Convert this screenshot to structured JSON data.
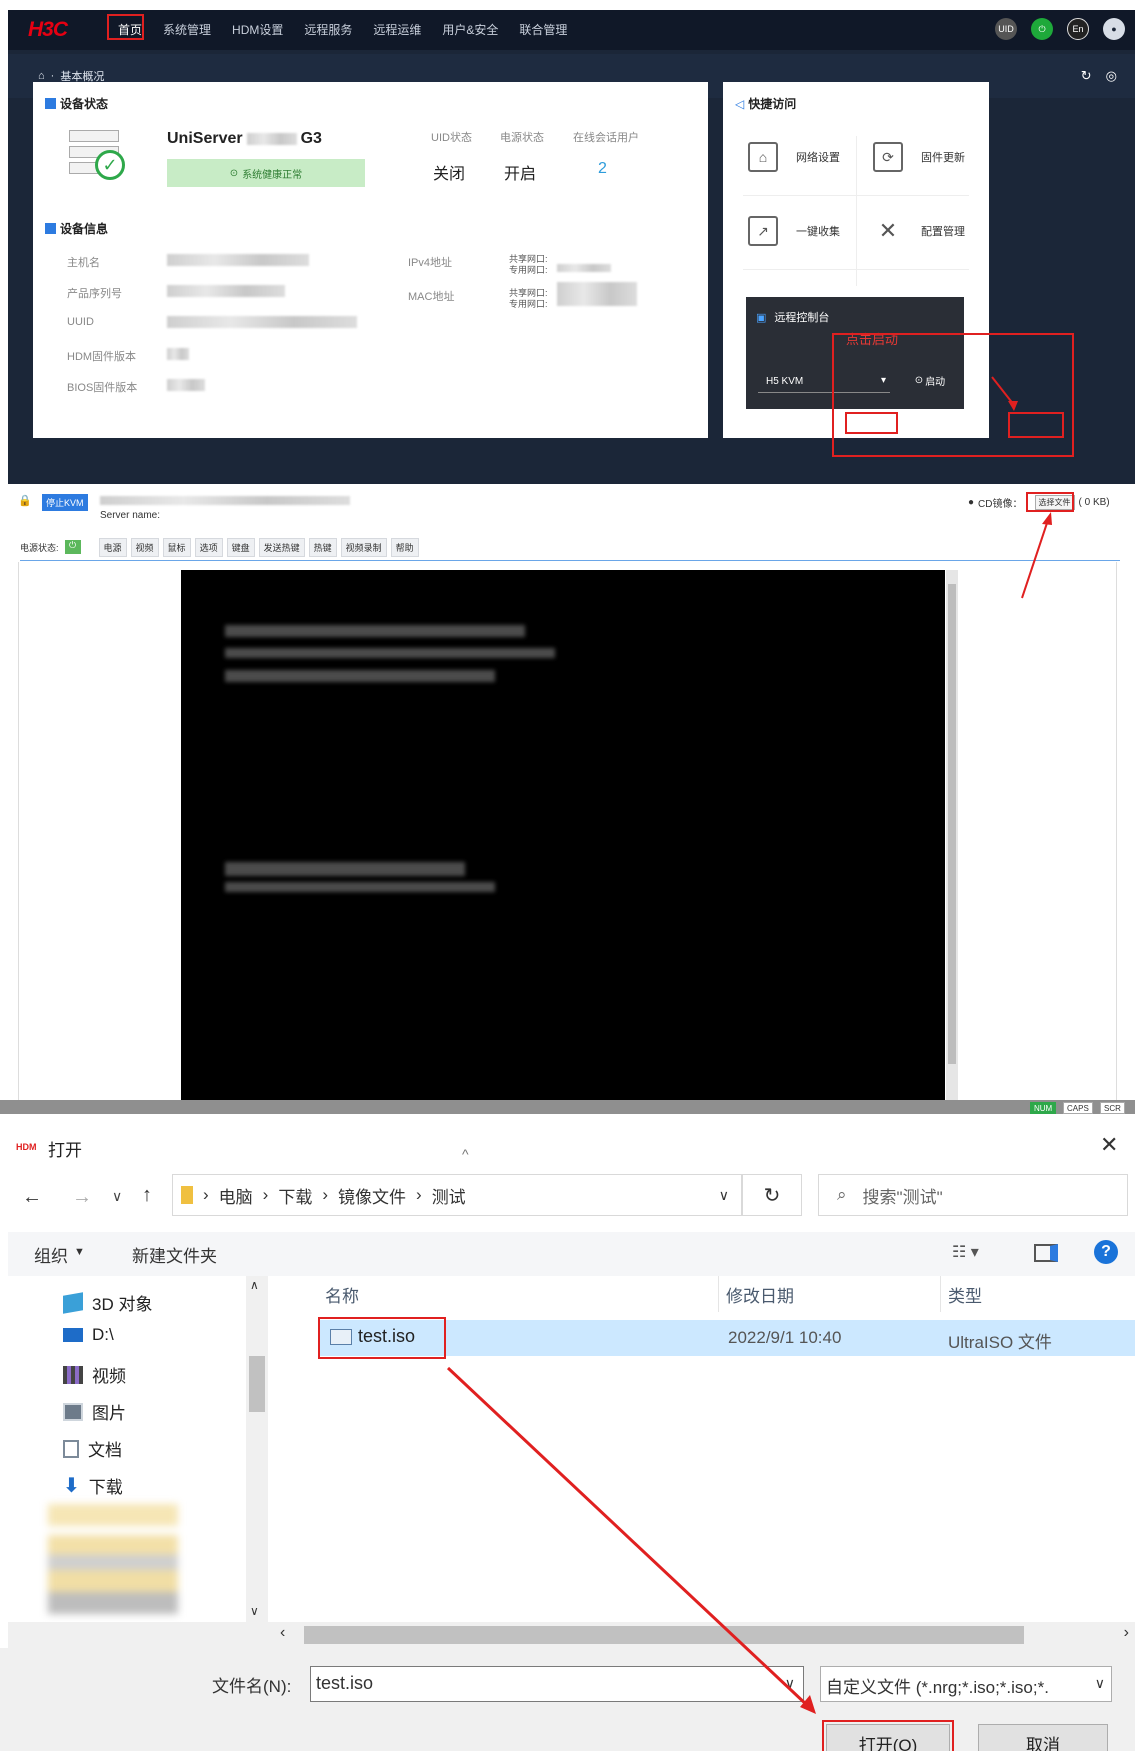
{
  "hdm": {
    "logo": "H3C",
    "nav": [
      "首页",
      "系统管理",
      "HDM设置",
      "远程服务",
      "远程运维",
      "用户&安全",
      "联合管理"
    ],
    "breadcrumb": "基本概况",
    "device_status": {
      "title": "设备状态",
      "model_prefix": "UniServer",
      "model_suffix": "G3",
      "health": "系统健康正常",
      "uid_label": "UID状态",
      "uid_value": "关闭",
      "power_label": "电源状态",
      "power_value": "开启",
      "sessions_label": "在线会话用户",
      "sessions_value": "2"
    },
    "device_info": {
      "title": "设备信息",
      "labels": [
        "主机名",
        "产品序列号",
        "UUID",
        "HDM固件版本",
        "BIOS固件版本"
      ],
      "ipv4_label": "IPv4地址",
      "mac_label": "MAC地址",
      "shared_port": "共享网口:",
      "dedicated_port": "专用网口:"
    },
    "quick_access": {
      "title": "快捷访问",
      "items": [
        "网络设置",
        "固件更新",
        "一键收集",
        "配置管理"
      ]
    },
    "remote_console": {
      "title": "远程控制台",
      "annotation": "点击启动",
      "select_value": "H5 KVM",
      "launch_label": "启动"
    }
  },
  "kvm": {
    "stop_label": "停止KVM",
    "server_name_label": "Server name:",
    "cd_label": "CD镜像：",
    "choose_file": "选择文件",
    "file_size": "( 0 KB)",
    "power_label": "电源状态:",
    "menus": [
      "电源",
      "视频",
      "鼠标",
      "选项",
      "键盘",
      "发送热键",
      "热键",
      "视频录制",
      "帮助"
    ],
    "status": [
      "NUM",
      "CAPS",
      "SCR"
    ]
  },
  "dialog": {
    "app_badge": "HDM",
    "title": "打开",
    "path": [
      "电脑",
      "下载",
      "镜像文件",
      "测试"
    ],
    "search_placeholder": "搜索\"测试\"",
    "organize": "组织",
    "new_folder": "新建文件夹",
    "sidebar": [
      "3D 对象",
      "D:\\",
      "视频",
      "图片",
      "文档",
      "下载"
    ],
    "columns": [
      "名称",
      "修改日期",
      "类型"
    ],
    "file": {
      "name": "test.iso",
      "date": "2022/9/1 10:40",
      "type": "UltraISO 文件"
    },
    "filename_label": "文件名(N):",
    "filename_value": "test.iso",
    "filter": "自定义文件 (*.nrg;*.iso;*.iso;*.",
    "open_btn": "打开(O)",
    "cancel_btn": "取消"
  }
}
